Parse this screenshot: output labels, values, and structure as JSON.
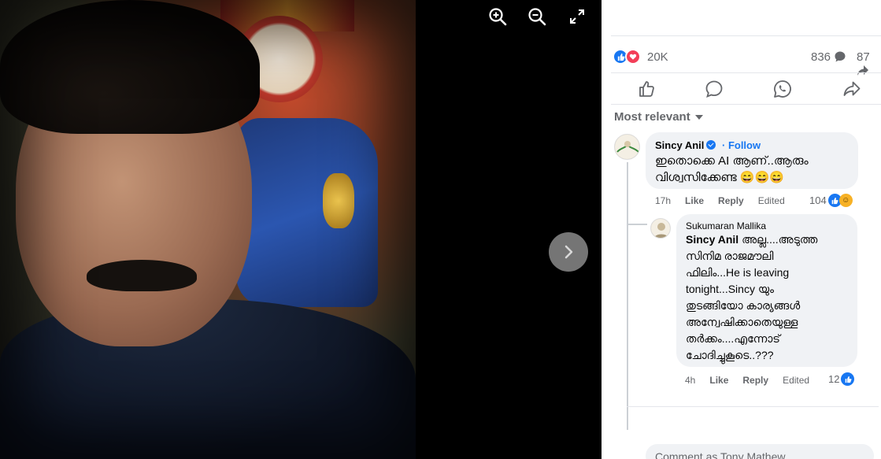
{
  "viewer": {
    "zoom_in_label": "Zoom in",
    "zoom_out_label": "Zoom out",
    "fullscreen_label": "Fullscreen",
    "next_label": "Next photo"
  },
  "post_stats": {
    "reactions": "20K",
    "comments": "836",
    "shares": "87"
  },
  "comments_sort": "Most relevant",
  "comments": [
    {
      "author": "Sincy Anil",
      "verified": true,
      "follow_label": "Follow",
      "lines": [
        "ഇതൊക്കെ AI ആണ്..ആരും",
        "വിശ്വസിക്കേണ്ട 😄😄😄"
      ],
      "time": "17h",
      "like_label": "Like",
      "reply_label": "Reply",
      "edited_label": "Edited",
      "reaction_count": "104"
    },
    {
      "author": "Sukumaran Mallika",
      "mention": "Sincy Anil",
      "lines": [
        "അല്ല....അടുത്ത",
        "സിനിമ രാജമൗലി",
        "ഫിലിം...He is leaving",
        "tonight...Sincy യും",
        "തുടങ്ങിയോ കാര്യങ്ങൾ",
        "അന്വേഷിക്കാതെയുള്ള",
        "തർക്കം....എന്നോട്",
        "ചോദിച്ചുകൂടെ..???"
      ],
      "time": "4h",
      "like_label": "Like",
      "reply_label": "Reply",
      "edited_label": "Edited",
      "reaction_count": "12"
    }
  ],
  "composer_placeholder": "Comment as Tony Mathew",
  "colors": {
    "accent": "#1877f2",
    "love": "#f33e58",
    "haha": "#f7b125",
    "bubble": "#f0f2f5",
    "muted": "#65676b"
  }
}
